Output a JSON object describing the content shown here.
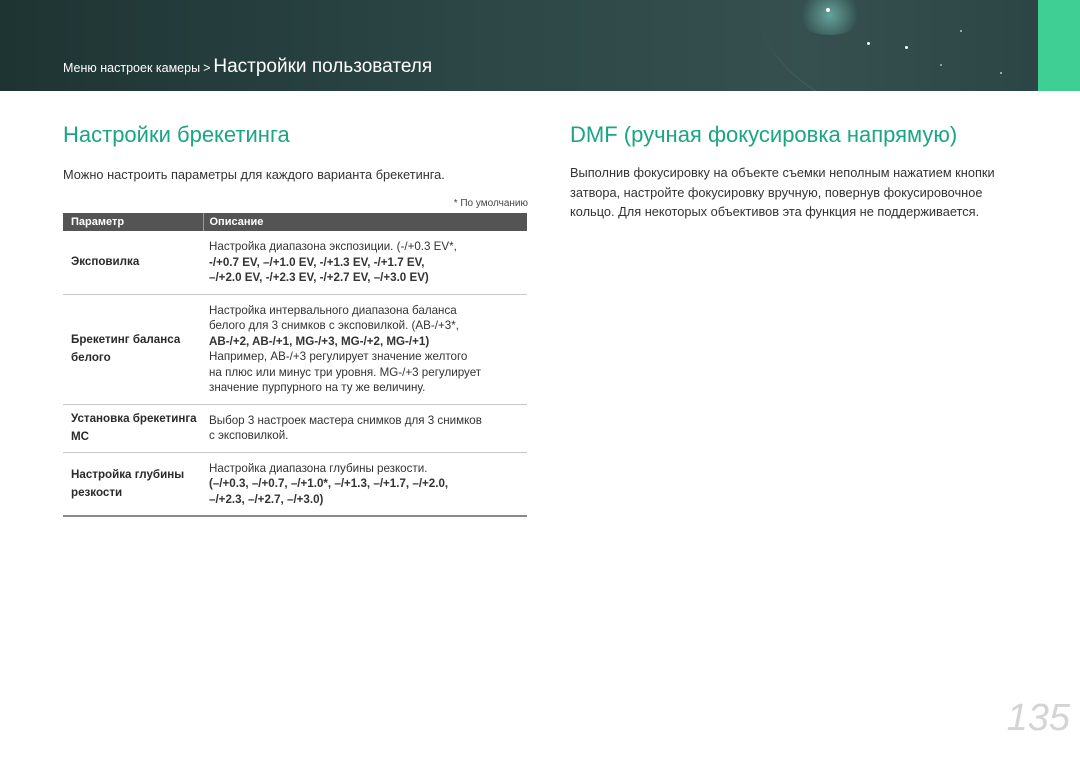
{
  "header": {
    "breadcrumb_parent": "Меню настроек камеры",
    "breadcrumb_separator": ">",
    "breadcrumb_current": "Настройки пользователя",
    "background_color": "#2c4746",
    "tab_color": "#3fcf95"
  },
  "left": {
    "title": "Настройки брекетинга",
    "intro": "Можно настроить параметры для каждого варианта брекетинга.",
    "default_note": "* По умолчанию",
    "table": {
      "headers": [
        "Параметр",
        "Описание"
      ],
      "rows": [
        {
          "param": "Эксповилка",
          "desc_lines": [
            "Настройка диапазона экспозиции. (-/+0.3 EV*,",
            "-/+0.7 EV, –/+1.0 EV, -/+1.3 EV, -/+1.7 EV,",
            "–/+2.0 EV, -/+2.3 EV, -/+2.7 EV, –/+3.0 EV)"
          ]
        },
        {
          "param": "Брекетинг баланса белого",
          "desc_lines": [
            "Настройка интервального диапазона баланса",
            "белого для 3 снимков с эксповилкой. (AB-/+3*,",
            "AB-/+2, AB-/+1, MG-/+3, MG-/+2, MG-/+1)",
            "Например, AB-/+3 регулирует значение желтого",
            "на плюс или минус три уровня. MG-/+3 регулирует",
            "значение пурпурного на ту же величину."
          ]
        },
        {
          "param": "Установка брекетинга МС",
          "desc_lines": [
            "Выбор 3 настроек мастера снимков для 3 снимков",
            "с эксповилкой."
          ]
        },
        {
          "param": "Настройка глубины резкости",
          "desc_lines": [
            "Настройка диапазона глубины резкости.",
            "(–/+0.3, –/+0.7, –/+1.0*, –/+1.3, –/+1.7, –/+2.0,",
            "–/+2.3, –/+2.7, –/+3.0)"
          ]
        }
      ]
    }
  },
  "right": {
    "title": "DMF (ручная фокусировка напрямую)",
    "body": "Выполнив фокусировку на объекте съемки неполным нажатием кнопки затвора, настройте фокусировку вручную, повернув фокусировочное кольцо. Для некоторых объективов эта функция не поддерживается."
  },
  "page_number": "135",
  "accent_color": "#1aa583"
}
